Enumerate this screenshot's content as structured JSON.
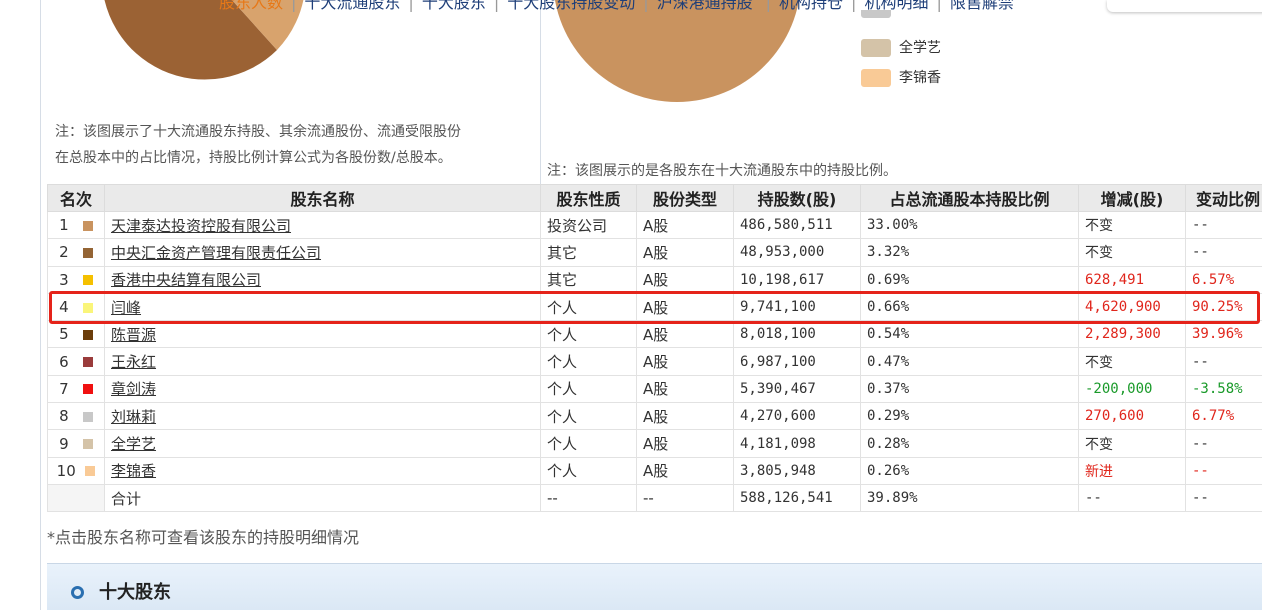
{
  "nav": {
    "tabs": [
      {
        "label": "股东人数",
        "active": true
      },
      {
        "label": "十大流通股东",
        "active": false
      },
      {
        "label": "十大股东",
        "active": false
      },
      {
        "label": "十大股东持股变动",
        "active": false
      },
      {
        "label": "沪深港通持股",
        "active": false,
        "badge_dot": true
      },
      {
        "label": "机构持仓",
        "active": false
      },
      {
        "label": "机构明细",
        "active": false
      },
      {
        "label": "限售解禁",
        "active": false
      }
    ]
  },
  "left_chart": {
    "note_line1": "注：该图展示了十大流通股东持股、其余流通股份、流通受限股份",
    "note_line2": "在总股本中的占比情况，持股比例计算公式为各股份数/总股本。"
  },
  "right_chart": {
    "note": "注：该图展示的是各股东在十大流通股东中的持股比例。",
    "legend": [
      {
        "label": "全学艺",
        "color": "#d4c3a8"
      },
      {
        "label": "李锦香",
        "color": "#f9ca96"
      }
    ]
  },
  "table": {
    "headers": [
      "名次",
      "股东名称",
      "股东性质",
      "股份类型",
      "持股数(股)",
      "占总流通股本持股比例",
      "增减(股)",
      "变动比例"
    ],
    "rows": [
      {
        "rank": "1",
        "color": "#c9935f",
        "name": "天津泰达投资控股有限公司",
        "nature": "投资公司",
        "type": "A股",
        "shares": "486,580,511",
        "ratio": "33.00%",
        "change": "不变",
        "change_pct": "--",
        "tone": "neutral"
      },
      {
        "rank": "2",
        "color": "#946434",
        "name": "中央汇金资产管理有限责任公司",
        "nature": "其它",
        "type": "A股",
        "shares": "48,953,000",
        "ratio": "3.32%",
        "change": "不变",
        "change_pct": "--",
        "tone": "neutral"
      },
      {
        "rank": "3",
        "color": "#f5c000",
        "name": "香港中央结算有限公司",
        "nature": "其它",
        "type": "A股",
        "shares": "10,198,617",
        "ratio": "0.69%",
        "change": "628,491",
        "change_pct": "6.57%",
        "tone": "up"
      },
      {
        "rank": "4",
        "color": "#faf57a",
        "name": "闫峰",
        "nature": "个人",
        "type": "A股",
        "shares": "9,741,100",
        "ratio": "0.66%",
        "change": "4,620,900",
        "change_pct": "90.25%",
        "tone": "up"
      },
      {
        "rank": "5",
        "color": "#6b3d0a",
        "name": "陈晋源",
        "nature": "个人",
        "type": "A股",
        "shares": "8,018,100",
        "ratio": "0.54%",
        "change": "2,289,300",
        "change_pct": "39.96%",
        "tone": "up"
      },
      {
        "rank": "6",
        "color": "#9a3b3b",
        "name": "王永红",
        "nature": "个人",
        "type": "A股",
        "shares": "6,987,100",
        "ratio": "0.47%",
        "change": "不变",
        "change_pct": "--",
        "tone": "neutral"
      },
      {
        "rank": "7",
        "color": "#f01010",
        "name": "章剑涛",
        "nature": "个人",
        "type": "A股",
        "shares": "5,390,467",
        "ratio": "0.37%",
        "change": "-200,000",
        "change_pct": "-3.58%",
        "tone": "down"
      },
      {
        "rank": "8",
        "color": "#c8c8c8",
        "name": "刘琳莉",
        "nature": "个人",
        "type": "A股",
        "shares": "4,270,600",
        "ratio": "0.29%",
        "change": "270,600",
        "change_pct": "6.77%",
        "tone": "up"
      },
      {
        "rank": "9",
        "color": "#d4c3a8",
        "name": "全学艺",
        "nature": "个人",
        "type": "A股",
        "shares": "4,181,098",
        "ratio": "0.28%",
        "change": "不变",
        "change_pct": "--",
        "tone": "neutral"
      },
      {
        "rank": "10",
        "color": "#f9ca96",
        "name": "李锦香",
        "nature": "个人",
        "type": "A股",
        "shares": "3,805,948",
        "ratio": "0.26%",
        "change": "新进",
        "change_pct": "--",
        "tone": "up"
      }
    ],
    "total": {
      "label": "合计",
      "nature": "--",
      "type": "--",
      "shares": "588,126,541",
      "ratio": "39.89%",
      "change": "--",
      "change_pct": "--"
    }
  },
  "footnote": "*点击股东名称可查看该股东的持股明细情况",
  "section": {
    "title": "十大股东"
  }
}
